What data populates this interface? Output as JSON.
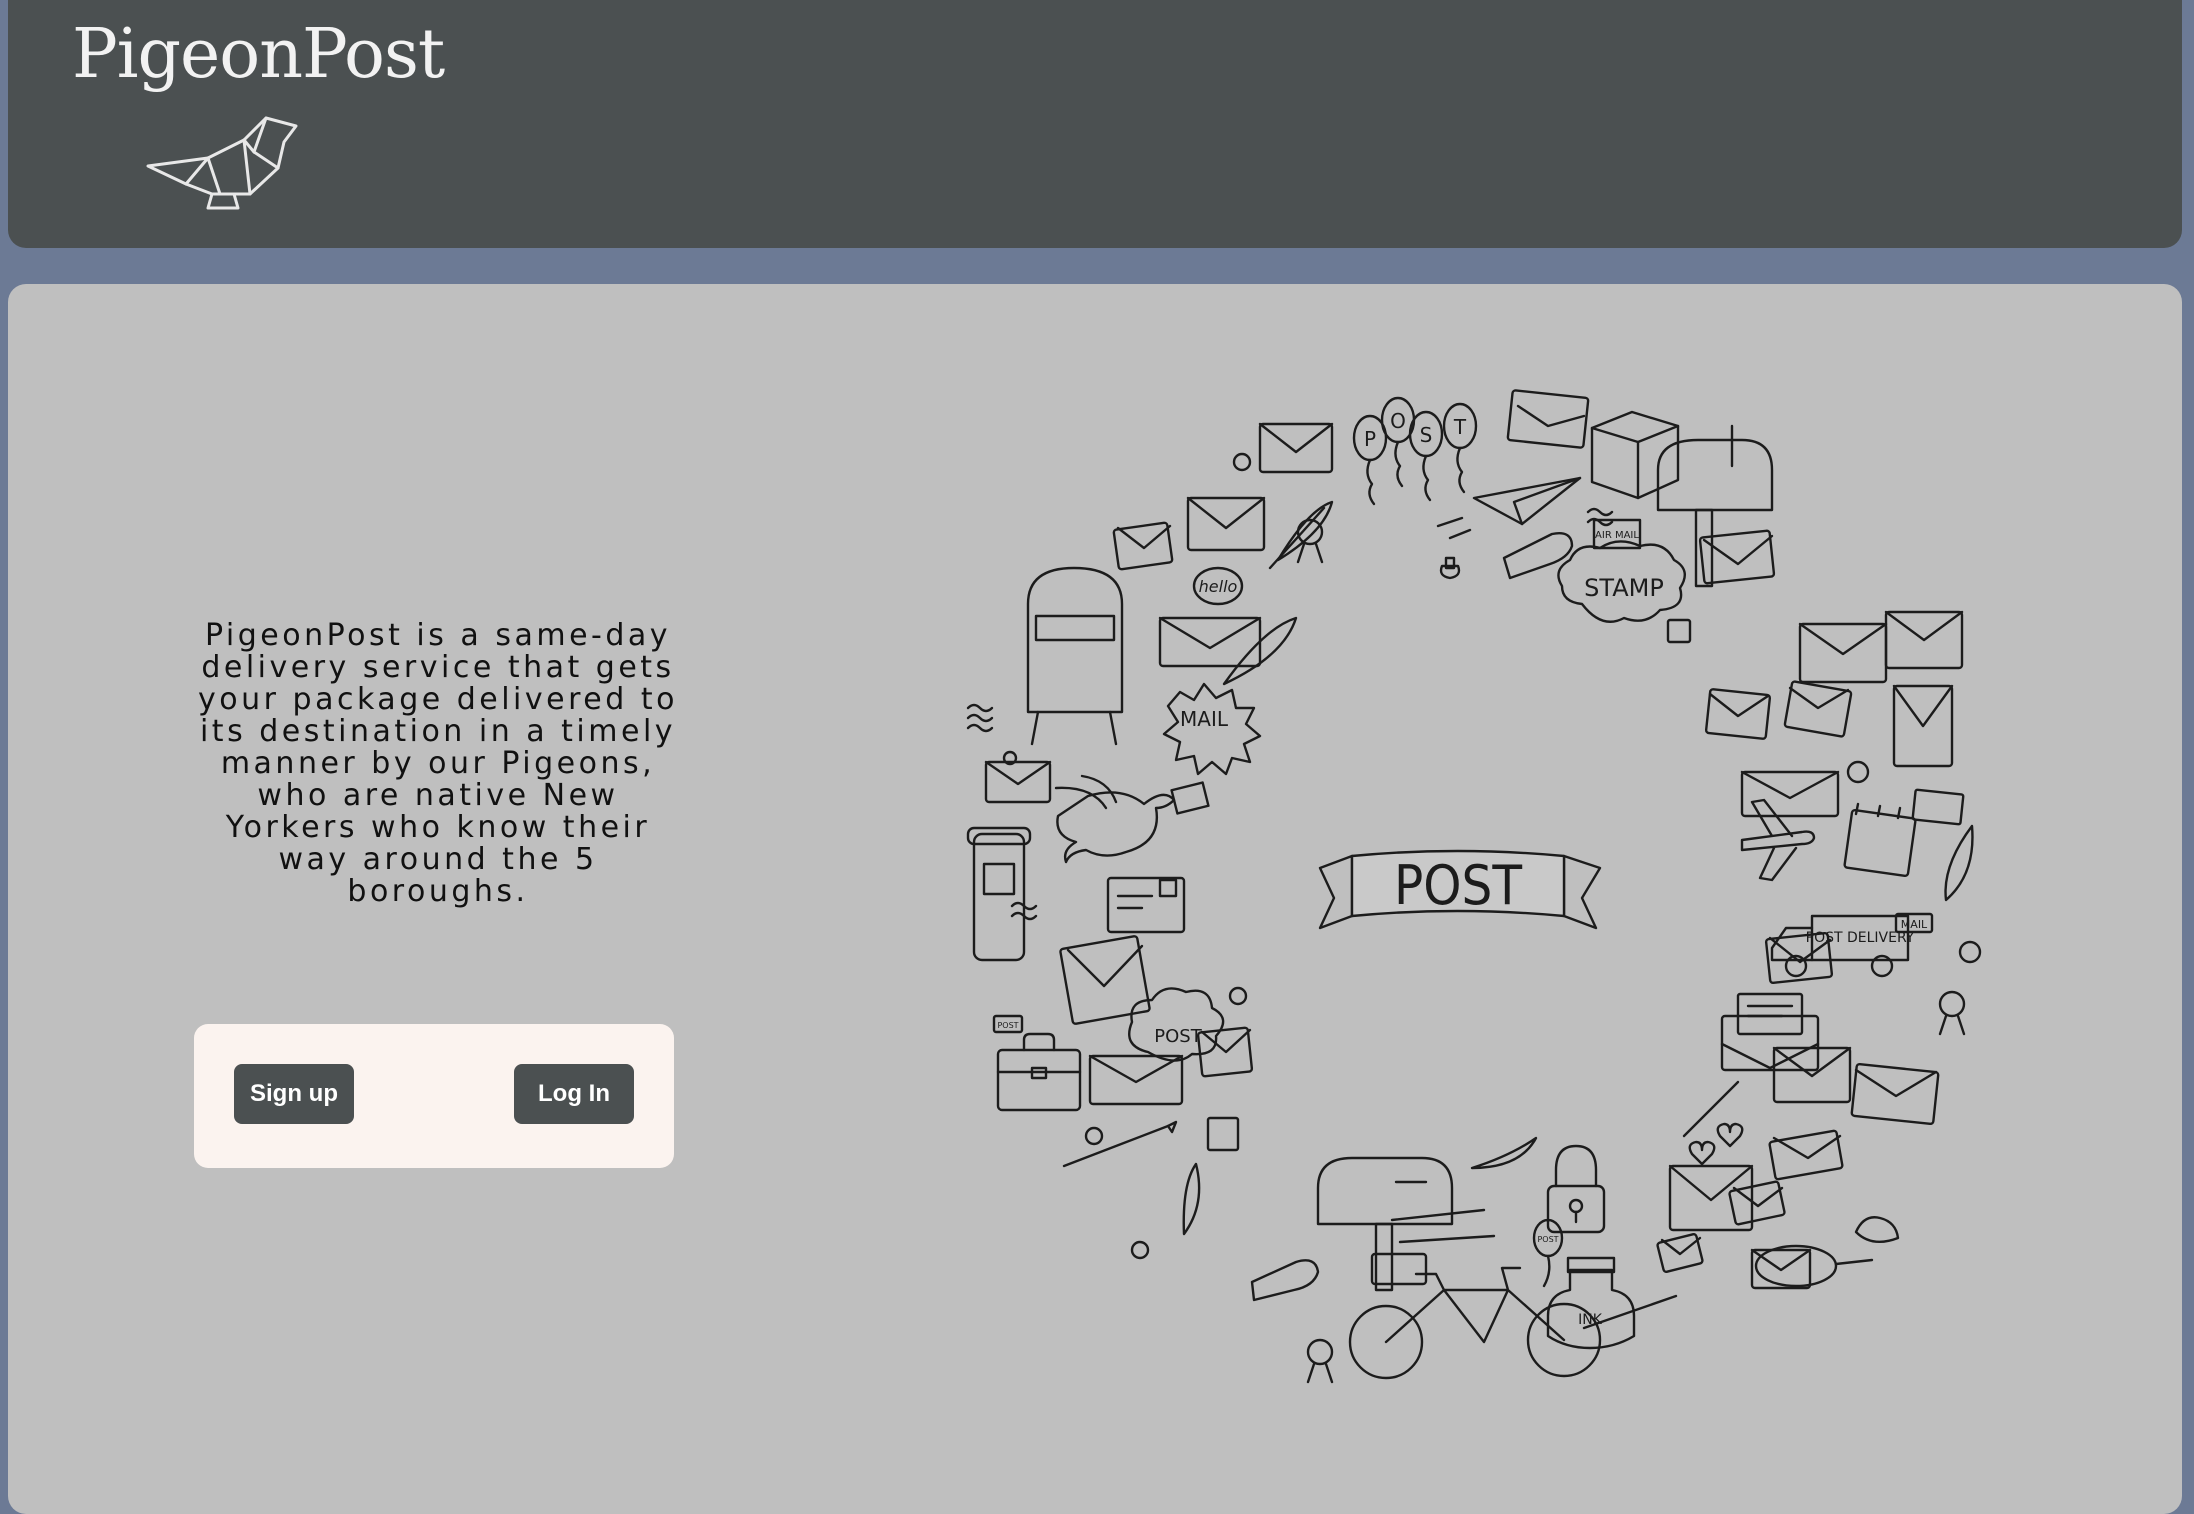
{
  "header": {
    "brand": "PigeonPost",
    "logo_icon": "origami-bird-icon"
  },
  "main": {
    "tagline": "PigeonPost is a same-day delivery service that gets your package delivered to its destination in a timely manner by our Pigeons, who are native New Yorkers who know their way around the 5 boroughs.",
    "auth": {
      "signup_label": "Sign up",
      "login_label": "Log In"
    },
    "illustration": {
      "center_label": "POST",
      "labels": [
        "P",
        "O",
        "S",
        "T",
        "STAMP",
        "MAIL",
        "hello",
        "POST",
        "AIR MAIL",
        "MAIL",
        "POST DELIVERY",
        "INK",
        "POST",
        "POST"
      ]
    }
  },
  "colors": {
    "page_bg": "#6c7a95",
    "header_bg": "#4b5051",
    "panel_bg": "#bfbfbf",
    "card_bg": "#fbf3ef",
    "button_bg": "#4b5051",
    "button_text": "#ffffff"
  }
}
